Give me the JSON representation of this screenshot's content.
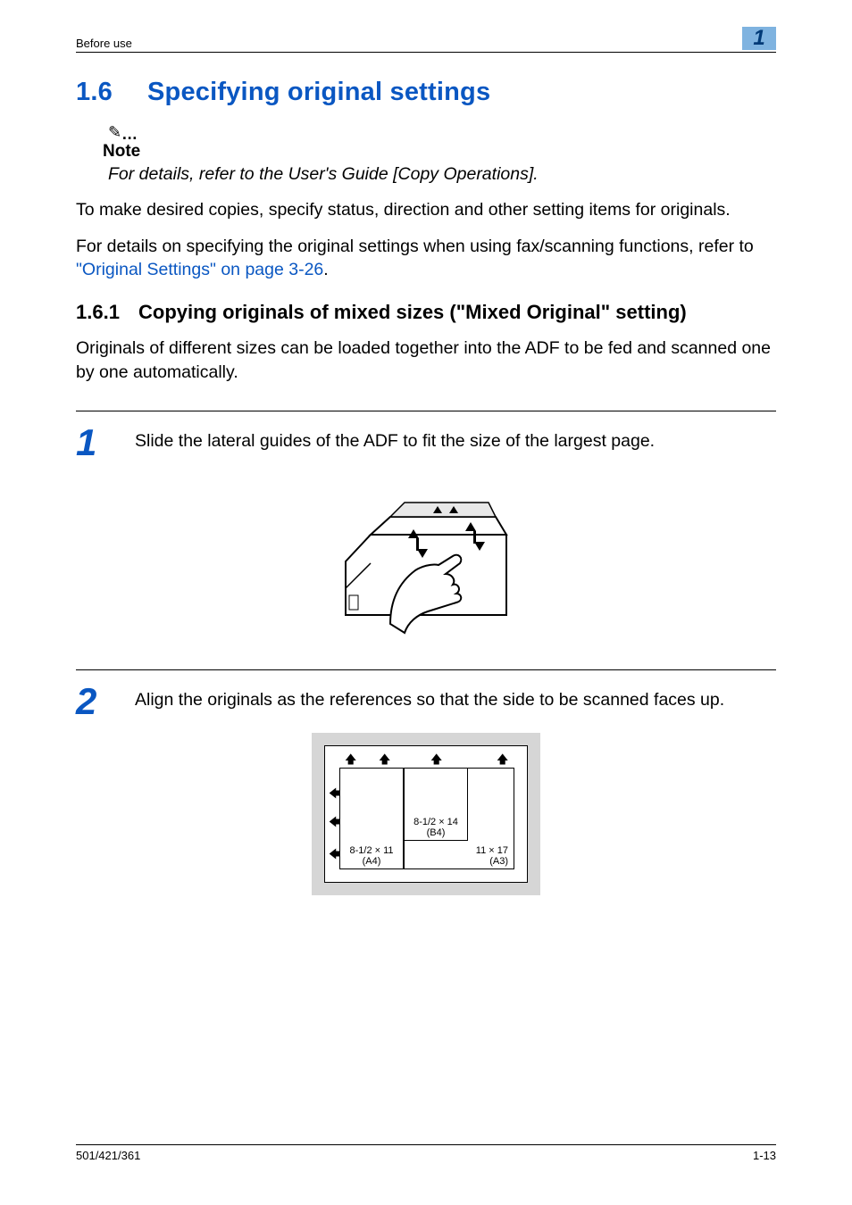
{
  "header": {
    "breadcrumb": "Before use",
    "chapter_num": "1"
  },
  "h1": {
    "num": "1.6",
    "text": "Specifying original settings"
  },
  "note": {
    "icon": "✎",
    "label": "Note",
    "body": "For details, refer to the User's Guide [Copy Operations]."
  },
  "para1": "To make desired copies, specify status, direction and other setting items for originals.",
  "para2_a": "For details on specifying the original settings when using fax/scanning functions, refer to ",
  "para2_link": "\"Original Settings\" on page 3-26",
  "para2_b": ".",
  "h2": {
    "num": "1.6.1",
    "text": "Copying originals of mixed sizes (\"Mixed Original\" setting)"
  },
  "para3": "Originals of different sizes can be loaded together into the ADF to be fed and scanned one by one automatically.",
  "steps": [
    {
      "num": "1",
      "text": "Slide the lateral guides of the ADF to fit the size of the largest page."
    },
    {
      "num": "2",
      "text": "Align the originals as the references so that the side to be scanned faces up."
    }
  ],
  "chart_data": {
    "type": "table",
    "title": "Paper size reference layout",
    "items": [
      {
        "label": "8-1/2 × 11",
        "sub": "(A4)"
      },
      {
        "label": "8-1/2 × 14",
        "sub": "(B4)"
      },
      {
        "label": "11 × 17",
        "sub": "(A3)"
      }
    ]
  },
  "footer": {
    "left": "501/421/361",
    "right": "1-13"
  }
}
